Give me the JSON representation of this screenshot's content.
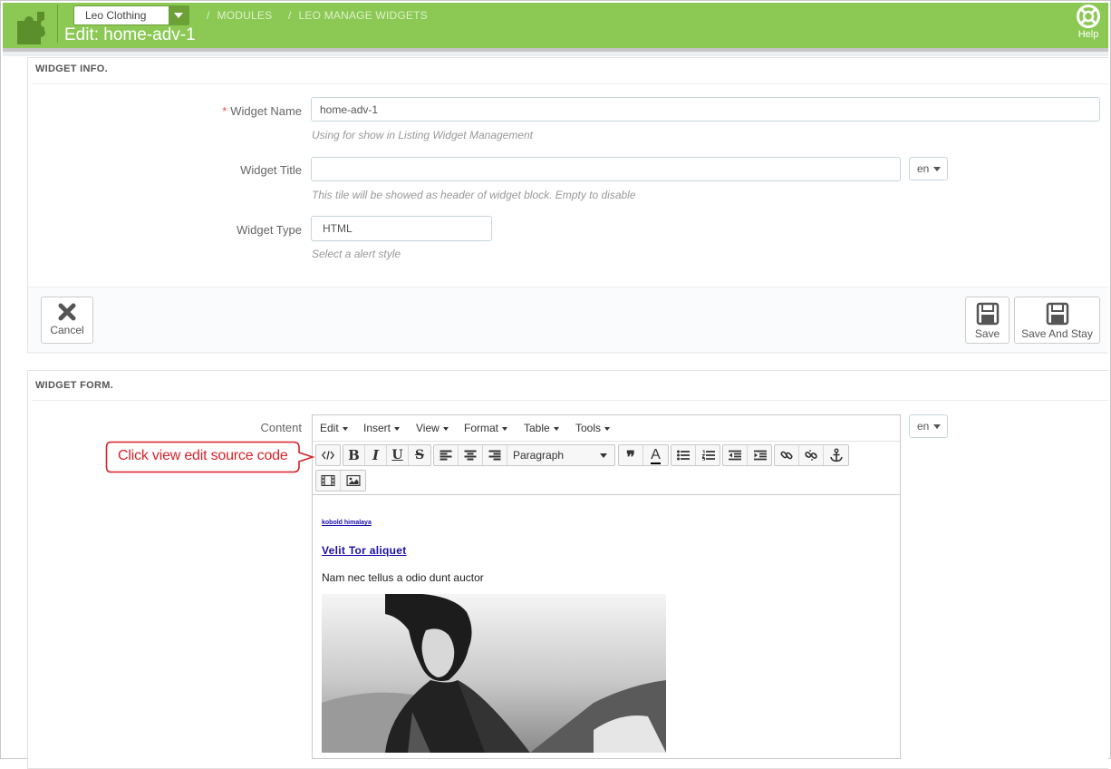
{
  "header": {
    "shop_selector": "Leo Clothing",
    "breadcrumb": [
      "MODULES",
      "LEO MANAGE WIDGETS"
    ],
    "page_title": "Edit: home-adv-1",
    "help_label": "Help",
    "accent_color": "#8bc954"
  },
  "widget_info": {
    "heading": "WIDGET INFO.",
    "name_label": "Widget Name",
    "name_required_mark": "*",
    "name_value": "home-adv-1",
    "name_help": "Using for show in Listing Widget Management",
    "title_label": "Widget Title",
    "title_value": "",
    "title_lang": "en",
    "title_help": "This tile will be showed as header of widget block. Empty to disable",
    "type_label": "Widget Type",
    "type_value": "HTML",
    "type_help": "Select a alert style",
    "cancel_label": "Cancel",
    "save_label": "Save",
    "save_stay_label": "Save And Stay"
  },
  "widget_form": {
    "heading": "WIDGET FORM.",
    "content_label": "Content",
    "content_lang": "en",
    "menus": [
      "Edit",
      "Insert",
      "View",
      "Format",
      "Table",
      "Tools"
    ],
    "block_format": "Paragraph",
    "toolbar_icons": [
      "source-code-icon",
      "bold-icon",
      "italic-icon",
      "underline-icon",
      "strikethrough-icon",
      "align-left-icon",
      "align-center-icon",
      "align-right-icon",
      "blockquote-icon",
      "text-color-icon",
      "bullet-list-icon",
      "numbered-list-icon",
      "outdent-icon",
      "indent-icon",
      "link-icon",
      "unlink-icon",
      "anchor-icon",
      "media-icon",
      "image-icon"
    ],
    "content": {
      "small_link": "kobold himalaya",
      "big_link": "Velit Tor aliquet",
      "paragraph": "Nam nec tellus a odio dunt auctor"
    }
  },
  "callout": {
    "text": "Click view edit source code",
    "color": "#d8232a"
  }
}
